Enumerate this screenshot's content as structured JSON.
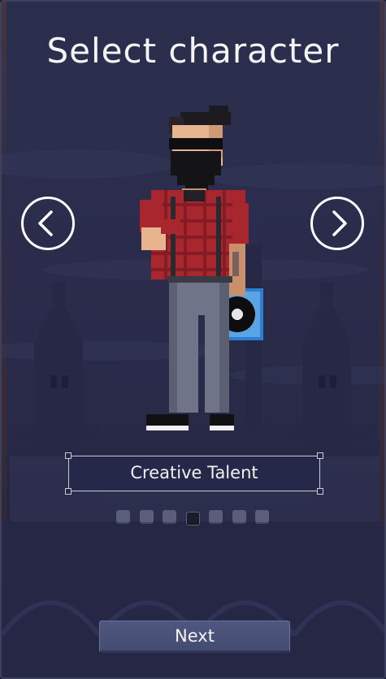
{
  "screen": {
    "title": "Select character"
  },
  "carousel": {
    "prev_icon": "chevron-left-icon",
    "next_icon": "chevron-right-icon",
    "character_name": "Creative Talent",
    "total_characters": 7,
    "selected_index": 3
  },
  "footer": {
    "next_label": "Next"
  },
  "colors": {
    "background": "#2a2d4b",
    "text": "#f4f4f6",
    "button": "#4f5780",
    "dot": "#5a5e7a",
    "dot_active": "#1a1c2c",
    "shirt": "#a8262e",
    "jeans": "#6f7488"
  }
}
